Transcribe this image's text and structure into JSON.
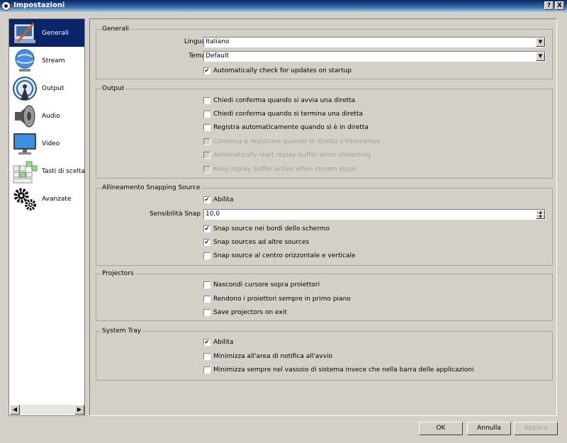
{
  "window": {
    "title": "Impostazioni",
    "help": "?",
    "close": "X"
  },
  "sidebar": {
    "items": [
      {
        "label": "Generali",
        "icon": "general-settings-icon",
        "selected": true
      },
      {
        "label": "Stream",
        "icon": "stream-globe-icon"
      },
      {
        "label": "Output",
        "icon": "output-broadcast-icon"
      },
      {
        "label": "Audio",
        "icon": "speaker-icon"
      },
      {
        "label": "Video",
        "icon": "monitor-icon"
      },
      {
        "label": "Tasti di scelta ra",
        "icon": "keyboard-icon"
      },
      {
        "label": "Avanzate",
        "icon": "gears-icon"
      }
    ],
    "scroll_left": "◀",
    "scroll_right": "▶"
  },
  "general": {
    "title": "Generali",
    "language_label": "Lingua",
    "language_value": "Italiano",
    "theme_label": "Tema",
    "theme_value": "Default",
    "dropdown_arrow": "▼",
    "update_check": {
      "label": "Automatically check for updates on startup",
      "checked": true
    }
  },
  "output": {
    "title": "Output",
    "options": [
      {
        "label": "Chiedi conferma quando si avvia una diretta",
        "checked": false,
        "enabled": true
      },
      {
        "label": "Chiedi conferma quando si termina una diretta",
        "checked": false,
        "enabled": true
      },
      {
        "label": "Registra automaticamente quando si è in diretta",
        "checked": false,
        "enabled": true
      },
      {
        "label": "Continua a registrare quando la diretta s'interrompe",
        "checked": false,
        "enabled": false
      },
      {
        "label": "Automatically start replay buffer when streaming",
        "checked": false,
        "enabled": false
      },
      {
        "label": "Keep replay buffer active when stream stops",
        "checked": false,
        "enabled": false
      }
    ]
  },
  "snapping": {
    "title": "Allineamento Snapping Source",
    "enable": {
      "label": "Abilita",
      "checked": true
    },
    "sensitivity_label": "Sensibilità Snap",
    "sensitivity_value": "10,0",
    "spin_up": "▲",
    "spin_down": "▼",
    "options": [
      {
        "label": "Snap source nei bordi dello schermo",
        "checked": true
      },
      {
        "label": "Snap sources ad altre sources",
        "checked": true
      },
      {
        "label": "Snap source al centro orizzontale e verticale",
        "checked": false
      }
    ]
  },
  "projectors": {
    "title": "Projectors",
    "options": [
      {
        "label": "Nascondi cursore sopra proiettori",
        "checked": false
      },
      {
        "label": "Rendono i proiettori sempre in primo piano",
        "checked": false
      },
      {
        "label": "Save projectors on exit",
        "checked": false
      }
    ]
  },
  "system_tray": {
    "title": "System Tray",
    "options": [
      {
        "label": "Abilita",
        "checked": true
      },
      {
        "label": "Minimizza all'area di notifica all'avvio",
        "checked": false
      },
      {
        "label": "Minimizza sempre nel vassoio di sistema invece che nella barra delle applicazioni",
        "checked": false
      }
    ]
  },
  "buttons": {
    "ok": "OK",
    "cancel": "Annulla",
    "apply": "Applica",
    "apply_enabled": false
  },
  "check_mark": "✔"
}
